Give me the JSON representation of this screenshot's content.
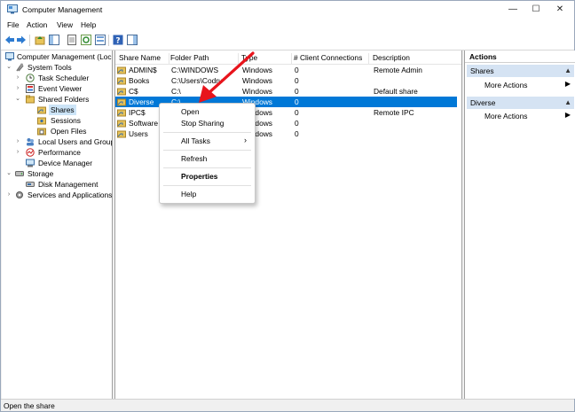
{
  "window": {
    "title": "Computer Management"
  },
  "menu": [
    "File",
    "Action",
    "View",
    "Help"
  ],
  "tree": {
    "root": "Computer Management (Local",
    "system_tools": "System Tools",
    "task_scheduler": "Task Scheduler",
    "event_viewer": "Event Viewer",
    "shared_folders": "Shared Folders",
    "shares": "Shares",
    "sessions": "Sessions",
    "open_files": "Open Files",
    "local_users": "Local Users and Groups",
    "performance": "Performance",
    "device_manager": "Device Manager",
    "storage": "Storage",
    "disk_management": "Disk Management",
    "services": "Services and Applications"
  },
  "columns": [
    "Share Name",
    "Folder Path",
    "Type",
    "# Client Connections",
    "Description"
  ],
  "rows": [
    {
      "name": "ADMIN$",
      "path": "C:\\WINDOWS",
      "type": "Windows",
      "clients": "0",
      "desc": "Remote Admin"
    },
    {
      "name": "Books",
      "path": "C:\\Users\\Codru",
      "type": "Windows",
      "clients": "0",
      "desc": ""
    },
    {
      "name": "C$",
      "path": "C:\\",
      "type": "Windows",
      "clients": "0",
      "desc": "Default share"
    },
    {
      "name": "Diverse",
      "path": "C:\\...",
      "type": "Windows",
      "clients": "0",
      "desc": ""
    },
    {
      "name": "IPC$",
      "path": "",
      "type": "Windows",
      "clients": "0",
      "desc": "Remote IPC"
    },
    {
      "name": "Software",
      "path": "",
      "type": "Windows",
      "clients": "0",
      "desc": ""
    },
    {
      "name": "Users",
      "path": "",
      "type": "Windows",
      "clients": "0",
      "desc": ""
    }
  ],
  "context_menu": {
    "open": "Open",
    "stop_sharing": "Stop Sharing",
    "all_tasks": "All Tasks",
    "refresh": "Refresh",
    "properties": "Properties",
    "help": "Help"
  },
  "actions": {
    "header": "Actions",
    "section1": "Shares",
    "section1_item": "More Actions",
    "section2": "Diverse",
    "section2_item": "More Actions"
  },
  "status": "Open the share",
  "colors": {
    "selection": "#0078d7",
    "arrow": "#e8141c",
    "section_bg": "#d5e3f3"
  }
}
